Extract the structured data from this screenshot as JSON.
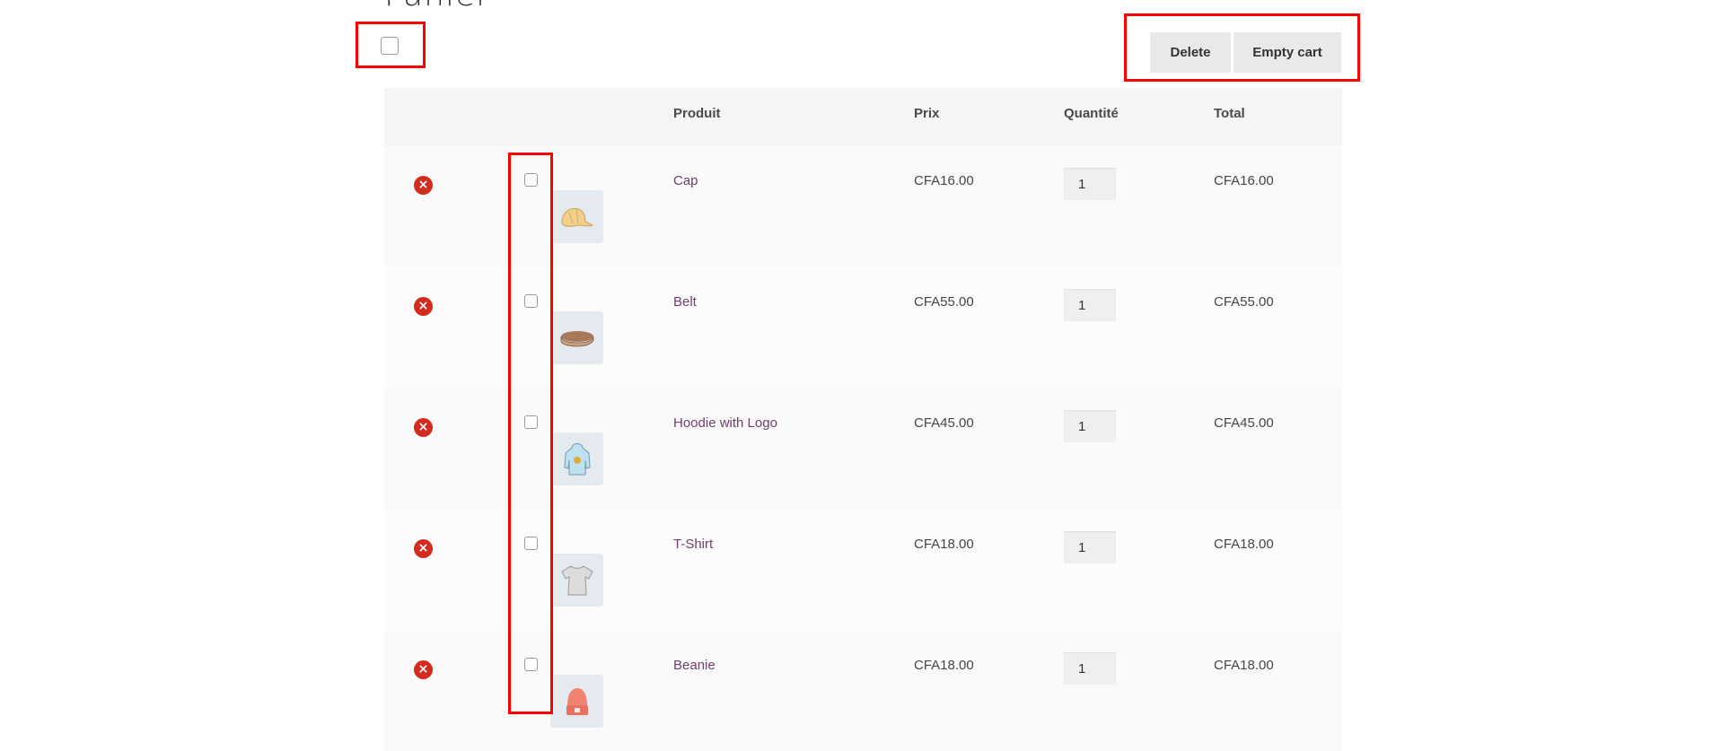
{
  "page": {
    "title": "Panier"
  },
  "actions": {
    "delete_label": "Delete",
    "empty_cart_label": "Empty cart"
  },
  "table": {
    "headers": {
      "remove": "",
      "select": "",
      "thumbnail": "",
      "product": "Produit",
      "price": "Prix",
      "quantity": "Quantité",
      "total": "Total"
    },
    "rows": [
      {
        "product": "Cap",
        "price": "CFA16.00",
        "quantity": "1",
        "total": "CFA16.00",
        "thumbnail_icon": "cap-icon",
        "selected": false
      },
      {
        "product": "Belt",
        "price": "CFA55.00",
        "quantity": "1",
        "total": "CFA55.00",
        "thumbnail_icon": "belt-icon",
        "selected": false
      },
      {
        "product": "Hoodie with Logo",
        "price": "CFA45.00",
        "quantity": "1",
        "total": "CFA45.00",
        "thumbnail_icon": "hoodie-icon",
        "selected": false
      },
      {
        "product": "T-Shirt",
        "price": "CFA18.00",
        "quantity": "1",
        "total": "CFA18.00",
        "thumbnail_icon": "tshirt-icon",
        "selected": false
      },
      {
        "product": "Beanie",
        "price": "CFA18.00",
        "quantity": "1",
        "total": "CFA18.00",
        "thumbnail_icon": "beanie-icon",
        "selected": false
      }
    ]
  },
  "icons": {
    "remove": "×"
  },
  "colors": {
    "accent_link": "#6d3f6b",
    "remove_red": "#d32b1e",
    "highlight": "#ff0000"
  }
}
